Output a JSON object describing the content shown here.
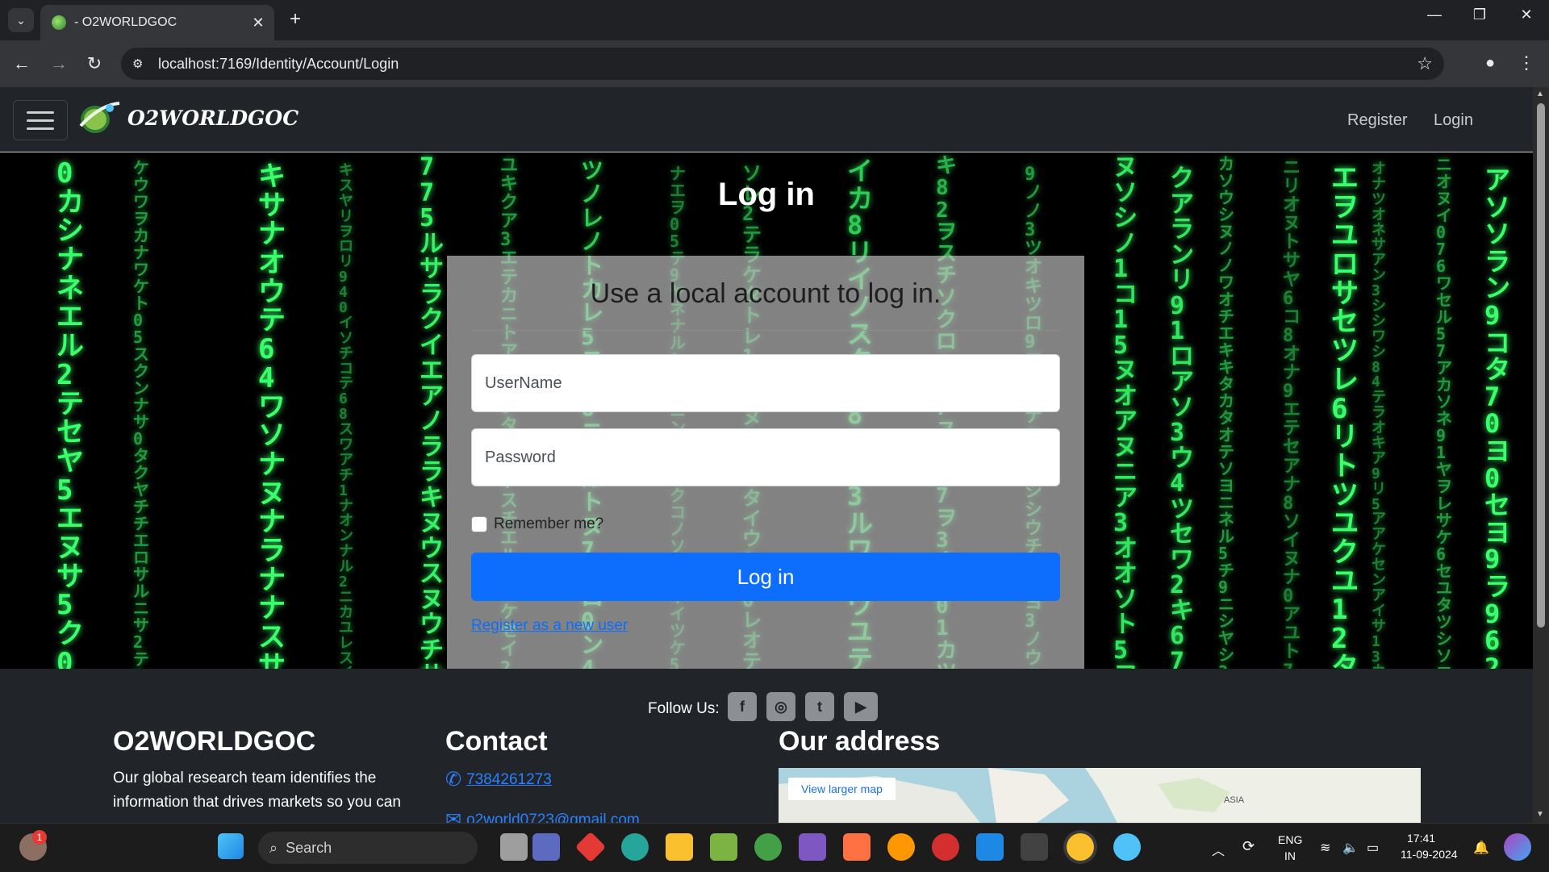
{
  "browser": {
    "tab_title": "- O2WORLDGOC",
    "tab_close": "✕",
    "new_tab": "+",
    "url": "localhost:7169/Identity/Account/Login"
  },
  "site": {
    "brand": "O2WORLDGOC",
    "nav": {
      "register": "Register",
      "login": "Login"
    }
  },
  "login": {
    "page_title": "Log in",
    "heading": "Use a local account to log in.",
    "username_placeholder": "UserName",
    "password_placeholder": "Password",
    "remember_label": "Remember me?",
    "remember_checked": false,
    "submit_label": "Log in",
    "register_link": "Register as a new user"
  },
  "footer": {
    "follow_label": "Follow Us:",
    "social_icons": [
      "facebook-icon",
      "instagram-icon",
      "twitter-icon",
      "youtube-icon"
    ],
    "about_heading": "O2WORLDGOC",
    "about_text": "Our global research team identifies the information that drives markets so you can",
    "contact_heading": "Contact",
    "phone": "7384261273",
    "email": "o2world0723@gmail.com",
    "address_heading": "Our address",
    "map_button": "View larger map",
    "map_label": "ASIA"
  },
  "taskbar": {
    "search_label": "Search",
    "notification_badge": "1",
    "lang_top": "ENG",
    "lang_bottom": "IN",
    "time": "17:41",
    "date": "11-09-2024"
  },
  "colors": {
    "primary_button": "#0d6efd",
    "navbar_bg": "#212529",
    "rain_green": "#39ff6a"
  }
}
